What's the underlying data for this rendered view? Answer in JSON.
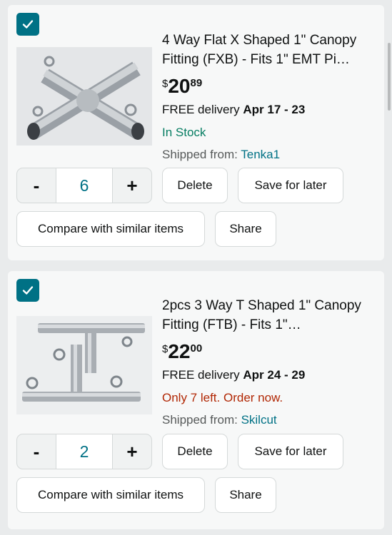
{
  "cart": {
    "items": [
      {
        "title": "4 Way Flat X Shaped 1\" Canopy Fitting (FXB) - Fits 1\" EMT Pi…",
        "price_currency": "$",
        "price_whole": "20",
        "price_fraction": "89",
        "delivery_prefix": "FREE delivery ",
        "delivery_dates": "Apr 17 - 23",
        "stock": "In Stock",
        "stock_color": "#067d62",
        "shipped_from_label": "Shipped from: ",
        "seller": "Tenka1",
        "quantity": "6",
        "checked": true,
        "image_icon": "x-shaped-fitting-image"
      },
      {
        "title": "2pcs 3 Way T Shaped 1\" Canopy Fitting (FTB) - Fits 1\"…",
        "price_currency": "$",
        "price_whole": "22",
        "price_fraction": "00",
        "delivery_prefix": "FREE delivery ",
        "delivery_dates": "Apr 24 - 29",
        "stock": "Only 7 left. Order now.",
        "stock_color": "#b12704",
        "shipped_from_label": "Shipped from: ",
        "seller": "Skilcut",
        "quantity": "2",
        "checked": true,
        "image_icon": "t-shaped-fitting-image"
      }
    ],
    "buttons": {
      "decrement": "-",
      "increment": "+",
      "delete": "Delete",
      "save_for_later": "Save for later",
      "compare": "Compare with similar items",
      "share": "Share"
    },
    "colors": {
      "accent": "#007185",
      "background": "#e9ebec",
      "card": "#f7f8f8"
    }
  }
}
